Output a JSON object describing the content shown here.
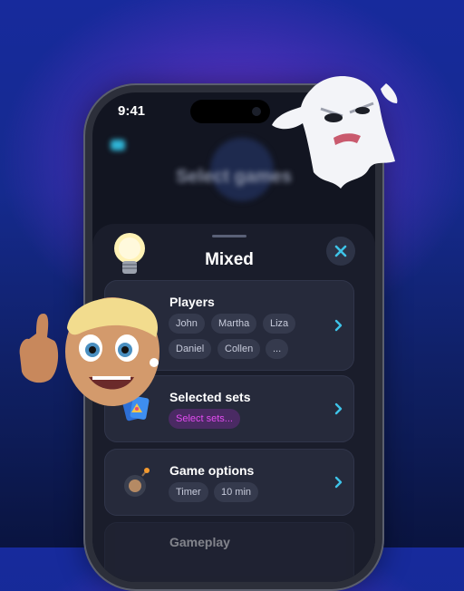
{
  "status_bar": {
    "time": "9:41"
  },
  "background_screen": {
    "title": "Select games"
  },
  "sheet": {
    "title": "Mixed",
    "cards": {
      "players": {
        "title": "Players",
        "chips": [
          "John",
          "Martha",
          "Liza",
          "Daniel",
          "Collen",
          "..."
        ]
      },
      "sets": {
        "title": "Selected sets",
        "chip": "Select sets..."
      },
      "options": {
        "title": "Game options",
        "chips": [
          "Timer",
          "10 min"
        ]
      },
      "gameplay": {
        "title": "Gameplay"
      }
    }
  },
  "colors": {
    "accent_cyan": "#2fb6d8",
    "pink_chip_text": "#e34cf2",
    "sheet_bg": "#1a1d2b",
    "card_bg": "#262a3b"
  },
  "icons": [
    "close-icon",
    "chevron-right-icon",
    "cards-icon",
    "bomb-icon",
    "lightbulb-icon",
    "ghost-icon",
    "memoji-avatar"
  ]
}
